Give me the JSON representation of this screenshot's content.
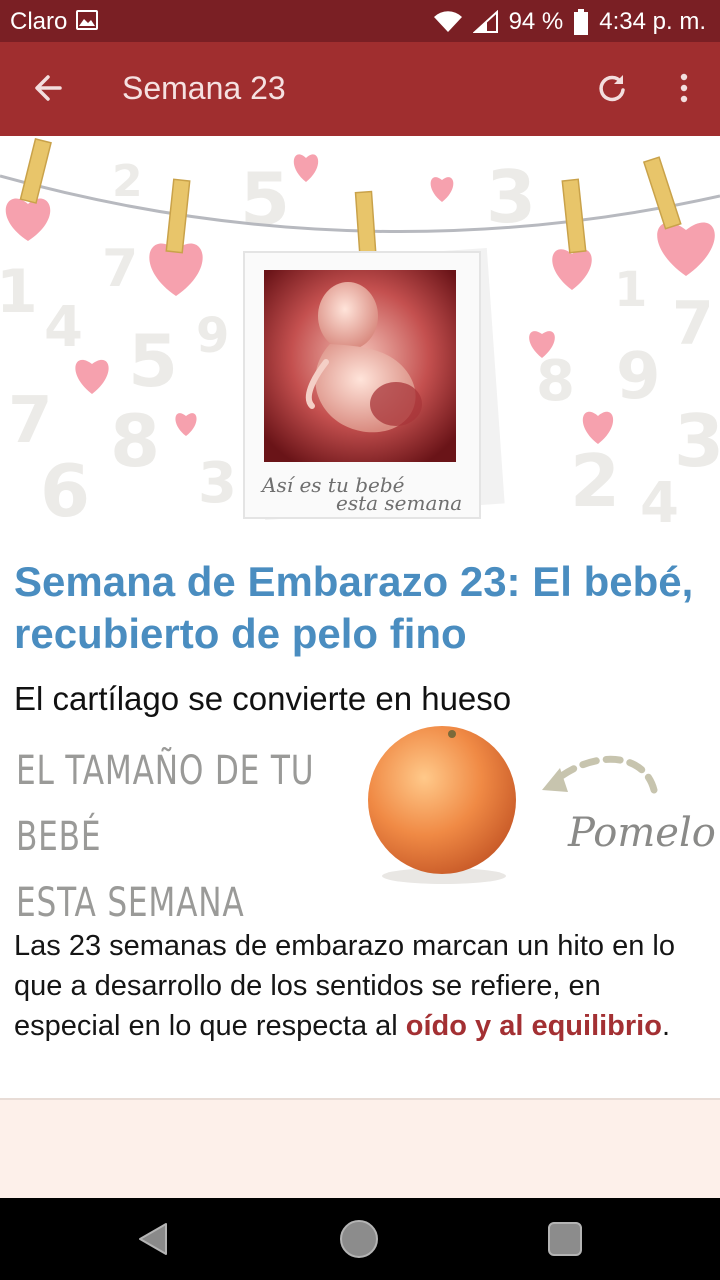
{
  "status_bar": {
    "carrier": "Claro",
    "battery": "94 %",
    "time": "4:34 p. m."
  },
  "toolbar": {
    "title": "Semana 23"
  },
  "hero": {
    "caption_line1": "Así es tu bebé",
    "caption_line2": "esta semana"
  },
  "article": {
    "headline": "Semana de Embarazo 23: El bebé, recubierto de pelo fino",
    "subhead": "El cartílago se convierte en hueso",
    "size_label_line1": "EL TAMAÑO DE TU BEBÉ",
    "size_label_line2": "ESTA SEMANA",
    "fruit_name": "Pomelo",
    "body_part1": "Las 23 semanas de embarazo marcan un hito en lo que a desarrollo de los sentidos se refiere, en especial en lo que respecta al ",
    "body_highlight": "oído y al equilibrio",
    "body_part2": "."
  },
  "colors": {
    "status_bar": "#7a1f24",
    "toolbar": "#a02e2f",
    "headline": "#4a8dc0",
    "highlight": "#a33033",
    "footer": "#fdf0ea"
  }
}
